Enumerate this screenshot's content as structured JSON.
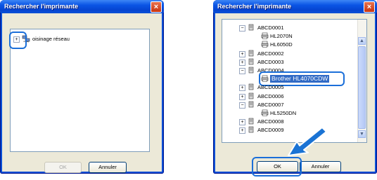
{
  "left_dialog": {
    "title": "Rechercher l'imprimante",
    "close_glyph": "×",
    "tree_root_expander": "+",
    "tree_root_label": "oisinage réseau",
    "ok_label": "OK",
    "cancel_label": "Annuler"
  },
  "right_dialog": {
    "title": "Rechercher l'imprimante",
    "close_glyph": "×",
    "tree": {
      "items": [
        {
          "label": "ABCD0001",
          "expander": "−",
          "icon": "computer-icon"
        },
        {
          "label": "HL2070N",
          "icon": "printer-icon"
        },
        {
          "label": "HL6050D",
          "icon": "printer-icon"
        },
        {
          "label": "ABCD0002",
          "expander": "+",
          "icon": "computer-icon"
        },
        {
          "label": "ABCD0003",
          "expander": "+",
          "icon": "computer-icon"
        },
        {
          "label": "ABCD0004",
          "expander": "−",
          "icon": "computer-icon"
        },
        {
          "label": "Brother HL4070CDW",
          "icon": "printer-icon",
          "selected": true
        },
        {
          "label": "ABCD0005",
          "expander": "+",
          "icon": "computer-icon"
        },
        {
          "label": "ABCD0006",
          "expander": "+",
          "icon": "computer-icon"
        },
        {
          "label": "ABCD0007",
          "expander": "−",
          "icon": "computer-icon"
        },
        {
          "label": "HL5250DN",
          "icon": "printer-icon"
        },
        {
          "label": "ABCD0008",
          "expander": "+",
          "icon": "computer-icon"
        },
        {
          "label": "ABCD0009",
          "expander": "+",
          "icon": "computer-icon"
        }
      ]
    },
    "scroll_up_glyph": "▲",
    "scroll_down_glyph": "▼",
    "ok_label": "OK",
    "cancel_label": "Annuler"
  },
  "colors": {
    "titlebar_blue": "#0a4fd6",
    "callout_blue": "#1b6fd9",
    "arrow_blue": "#1a73d4",
    "selection_blue": "#316ac5"
  }
}
